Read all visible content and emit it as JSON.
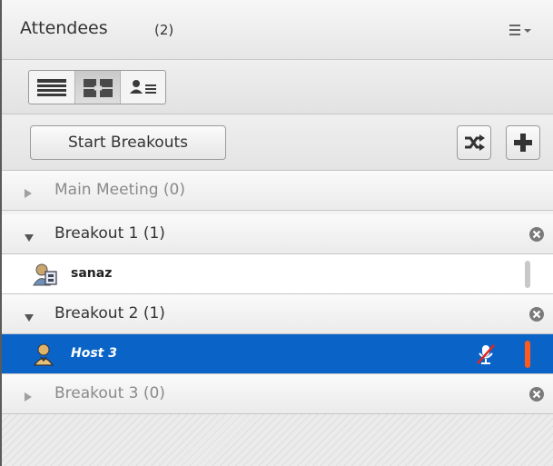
{
  "header": {
    "title": "Attendees",
    "count": "(2)",
    "menu_icon": "list-menu-icon"
  },
  "view_modes": [
    {
      "name": "list-view",
      "icon": "list-view-icon",
      "active": false
    },
    {
      "name": "breakout-view",
      "icon": "breakout-view-icon",
      "active": true
    },
    {
      "name": "roles-view",
      "icon": "roles-view-icon",
      "active": false
    }
  ],
  "actions": {
    "start_label": "Start Breakouts",
    "shuffle_icon": "shuffle-icon",
    "add_icon": "plus-icon"
  },
  "rooms": {
    "main": {
      "label": "Main Meeting (0)",
      "expanded": false
    },
    "breakout1": {
      "label": "Breakout 1 (1)",
      "expanded": true
    },
    "breakout2": {
      "label": "Breakout 2 (1)",
      "expanded": true
    },
    "breakout3": {
      "label": "Breakout 3 (0)",
      "expanded": false
    }
  },
  "attendees": {
    "sanaz": {
      "name": "sanaz",
      "role_icon": "participant-icon",
      "selected": false,
      "status_color": "#c8c8c8"
    },
    "host3": {
      "name": "Host 3",
      "role_icon": "host-icon",
      "selected": true,
      "status_color": "#ff5a1e",
      "mic_icon": "mic-muted-icon"
    }
  },
  "colors": {
    "selection": "#0a64c8",
    "status_active": "#ff5a1e"
  }
}
